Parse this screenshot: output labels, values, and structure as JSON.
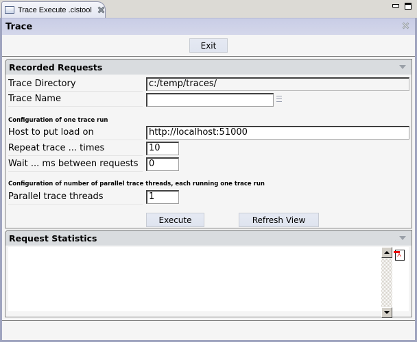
{
  "editor_tab": {
    "label": "Trace Execute .cistool",
    "icon": "editor-window-icon"
  },
  "form": {
    "title": "Trace"
  },
  "toolbar": {
    "exit_label": "Exit"
  },
  "recorded_requests": {
    "title": "Recorded Requests",
    "trace_directory": {
      "label": "Trace Directory",
      "value": "c:/temp/traces/"
    },
    "trace_name": {
      "label": "Trace Name",
      "value": ""
    },
    "one_run_heading": "Configuration of one trace run",
    "host": {
      "label": "Host to put load on",
      "value": "http://localhost:51000"
    },
    "repeat": {
      "label": "Repeat trace ... times",
      "value": "10"
    },
    "wait": {
      "label": "Wait ... ms between requests",
      "value": "0"
    },
    "parallel_heading": "Configuration of number of parallel trace threads, each running one trace run",
    "threads": {
      "label": "Parallel trace threads",
      "value": "1"
    },
    "execute_label": "Execute",
    "refresh_label": "Refresh View"
  },
  "request_statistics": {
    "title": "Request Statistics",
    "content": ""
  }
}
